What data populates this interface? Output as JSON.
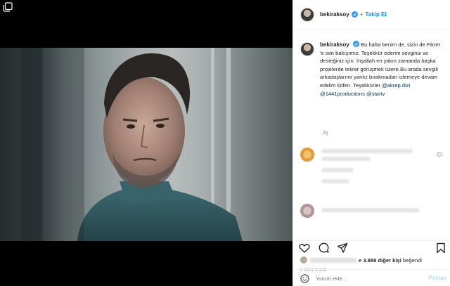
{
  "account": {
    "username": "bekiraksoy",
    "follow_label": "Takip Et",
    "dot": "•"
  },
  "caption": {
    "username": "bekiraksoy",
    "text_before": "Bu hafta benim de, sizin de Fikret 'e son bakışımız. Teşekkür ederim sevginiz ve desteğiniz için. İnşallah en yakın zamanda başka projelerde tekrar görüşmek üzere.Bu arada sevgili arkadaşlarımı yanlız bırakmadan izlemeye devam edelim lütfen. Teşekkürler ",
    "mention_1": "@akrep.dizi",
    "mention_2": "@1441productions",
    "mention_3": "@startv",
    "time": "2g"
  },
  "likes": {
    "text": "e 3.889 diğer kişi beğendi",
    "count_part": "e 3.889 diğer kişi",
    "suffix": "beğendi"
  },
  "post_time": "2 GÜN ÖNCE",
  "comment_box": {
    "placeholder": "Yorum ekle...",
    "post_label": "Paylaş"
  },
  "icons": {
    "gallery": "carousel-icon",
    "verified": "verified-badge-icon",
    "like": "heart-icon",
    "comment": "comment-icon",
    "share": "share-icon",
    "save": "bookmark-icon",
    "emoji": "smiley-icon"
  },
  "colors": {
    "link": "#0095f6",
    "mention": "#00376b",
    "muted": "#8e8e8e",
    "text": "#262626"
  }
}
